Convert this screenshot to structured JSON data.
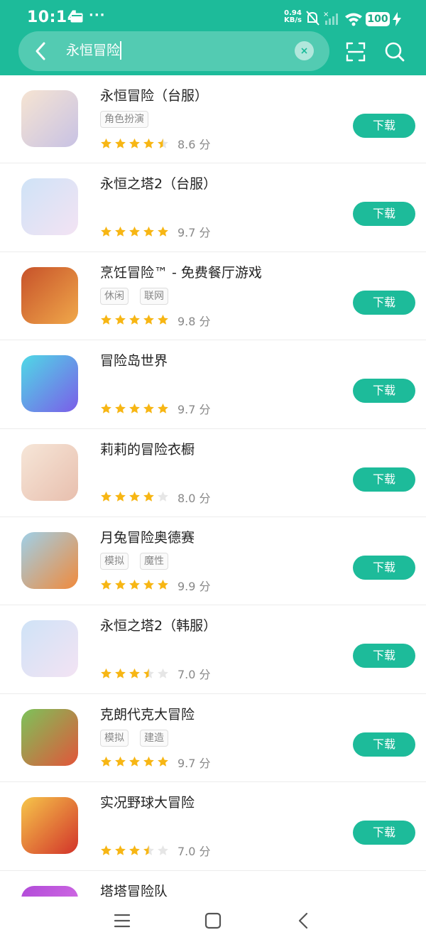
{
  "status_bar": {
    "time": "10:14",
    "dots": "···",
    "speed_value": "0.94",
    "speed_unit": "KB/s",
    "battery": "100"
  },
  "search": {
    "query": "永恒冒险",
    "clear_symbol": "×"
  },
  "download_label": "下载",
  "score_unit": "分",
  "apps": [
    {
      "name": "永恒冒险（台服）",
      "tags": [
        "角色扮演"
      ],
      "rating": 4.5,
      "score": "8.6",
      "icon": "anime-character-icon",
      "colors": [
        "#f6e4d2",
        "#c8c2e4"
      ]
    },
    {
      "name": "永恒之塔2（台服）",
      "tags": [],
      "rating": 5,
      "score": "9.7",
      "icon": "aion-logo-icon",
      "colors": [
        "#cfe3f7",
        "#f3e3f3"
      ]
    },
    {
      "name": "烹饪冒险™ - 免费餐厅游戏",
      "tags": [
        "休闲",
        "联网"
      ],
      "rating": 5,
      "score": "9.8",
      "icon": "steak-dish-icon",
      "colors": [
        "#c7522a",
        "#f0a84a"
      ]
    },
    {
      "name": "冒险岛世界",
      "tags": [],
      "rating": 5,
      "score": "9.7",
      "icon": "maplestory-worlds-icon",
      "colors": [
        "#4fd9e6",
        "#7b5de8"
      ]
    },
    {
      "name": "莉莉的冒险衣橱",
      "tags": [],
      "rating": 4,
      "score": "8.0",
      "icon": "girl-character-icon",
      "colors": [
        "#f6e6d8",
        "#e8bfae"
      ]
    },
    {
      "name": "月兔冒险奥德赛",
      "tags": [
        "模拟",
        "魔性"
      ],
      "rating": 5,
      "score": "9.9",
      "icon": "rabbit-carrot-icon",
      "colors": [
        "#9fd0e8",
        "#f08a3c"
      ]
    },
    {
      "name": "永恒之塔2（韩服）",
      "tags": [],
      "rating": 3.5,
      "score": "7.0",
      "icon": "aion-logo-icon",
      "colors": [
        "#cfe3f7",
        "#f3e3f3"
      ]
    },
    {
      "name": "克朗代克大冒险",
      "tags": [
        "模拟",
        "建造"
      ],
      "rating": 5,
      "score": "9.7",
      "icon": "farm-field-icon",
      "colors": [
        "#7cc35a",
        "#e2553a"
      ]
    },
    {
      "name": "实况野球大冒险",
      "tags": [],
      "rating": 3.5,
      "score": "7.0",
      "icon": "baseball-player-icon",
      "colors": [
        "#f6c64a",
        "#d2332a"
      ]
    },
    {
      "name": "塔塔冒险队",
      "tags": [],
      "rating": 0,
      "score": "",
      "icon": "cat-character-icon",
      "colors": [
        "#b04ad8",
        "#e07ae8"
      ]
    }
  ],
  "colors": {
    "accent": "#1dbb9a",
    "star": "#f7b614",
    "star_empty": "#e6e6e6"
  }
}
